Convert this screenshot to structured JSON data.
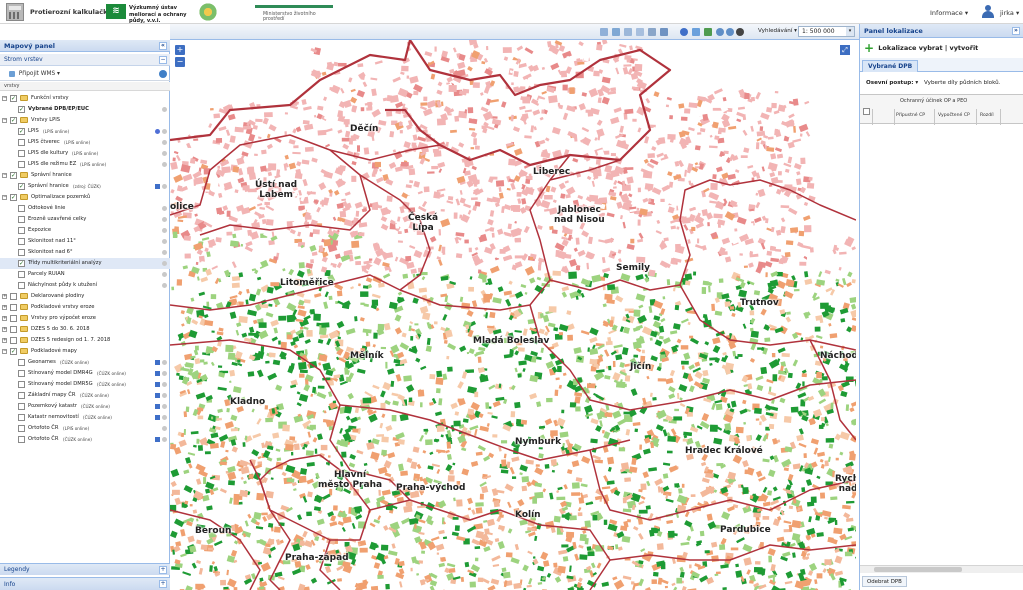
{
  "header": {
    "app_title": "Protierozní kalkulačka",
    "org_name": "Výzkumný ústav meliorací a ochrany půdy, v.v.i.",
    "ministry": "Ministerstvo životního prostředí",
    "info_menu": "Informace ▾",
    "user": "jirka ▾"
  },
  "left_panel": {
    "title": "Mapový panel",
    "subpanel": "Strom vrstev",
    "connect_wms": "Připojit WMS ▾",
    "column_header": "vrstvy",
    "tree": [
      {
        "label": "Funkční vrstvy",
        "level": 0,
        "type": "group",
        "checked": true,
        "expanded": true
      },
      {
        "label": "Vybrané DPB/EP/EUC",
        "level": 1,
        "type": "layer",
        "checked": true,
        "bold": true
      },
      {
        "label": "Vrstvy LPIS",
        "level": 0,
        "type": "group",
        "checked": true,
        "expanded": true
      },
      {
        "label": "LPIS",
        "suffix": "(LPIS online)",
        "level": 1,
        "type": "layer",
        "checked": true,
        "dot": "blue"
      },
      {
        "label": "LPIS čtverec",
        "suffix": "(LPIS online)",
        "level": 1,
        "type": "layer",
        "checked": false
      },
      {
        "label": "LPIS dle kultury",
        "suffix": "(LPIS online)",
        "level": 1,
        "type": "layer",
        "checked": false
      },
      {
        "label": "LPIS dle režimu EZ",
        "suffix": "(LPIS online)",
        "level": 1,
        "type": "layer",
        "checked": false
      },
      {
        "label": "Správní hranice",
        "level": 0,
        "type": "group",
        "checked": true,
        "expanded": true
      },
      {
        "label": "Správní hranice",
        "suffix": "(zdroj: ČÚZK)",
        "level": 1,
        "type": "layer",
        "checked": true,
        "square": true
      },
      {
        "label": "Optimalizace pozemků",
        "level": 0,
        "type": "group",
        "checked": true,
        "expanded": true
      },
      {
        "label": "Odtokové linie",
        "level": 1,
        "type": "layer",
        "checked": false
      },
      {
        "label": "Erozně uzavřené celky",
        "level": 1,
        "type": "layer",
        "checked": false
      },
      {
        "label": "Expozice",
        "level": 1,
        "type": "layer",
        "checked": false
      },
      {
        "label": "Sklonitost nad 11°",
        "level": 1,
        "type": "layer",
        "checked": false
      },
      {
        "label": "Sklonitost nad 6°",
        "level": 1,
        "type": "layer",
        "checked": false
      },
      {
        "label": "Třídy multikriteriální analýzy",
        "level": 1,
        "type": "layer",
        "checked": true,
        "selected": true
      },
      {
        "label": "Parcely RUIAN",
        "level": 1,
        "type": "layer",
        "checked": false
      },
      {
        "label": "Náchylnost půdy k utužení",
        "level": 1,
        "type": "layer",
        "checked": false
      },
      {
        "label": "Deklarované plodiny",
        "level": 0,
        "type": "group",
        "checked": false,
        "expanded": false
      },
      {
        "label": "Podkladové vrstvy eroze",
        "level": 0,
        "type": "group",
        "checked": false,
        "expanded": false
      },
      {
        "label": "Vrstvy pro výpočet eroze",
        "level": 0,
        "type": "group",
        "checked": false,
        "expanded": false
      },
      {
        "label": "DZES 5 do 30. 6. 2018",
        "level": 0,
        "type": "group",
        "checked": false,
        "expanded": false
      },
      {
        "label": "DZES 5 redesign od 1. 7. 2018",
        "level": 0,
        "type": "group",
        "checked": false,
        "expanded": false
      },
      {
        "label": "Podkladové mapy",
        "level": 0,
        "type": "group",
        "checked": true,
        "expanded": true
      },
      {
        "label": "Geonames",
        "suffix": "(ČÚZK online)",
        "level": 1,
        "type": "layer",
        "checked": false,
        "square": true
      },
      {
        "label": "Stínovaný model DMR4G",
        "suffix": "(ČÚZK online)",
        "level": 1,
        "type": "layer",
        "checked": false,
        "square": true
      },
      {
        "label": "Stínovaný model DMR5G",
        "suffix": "(ČÚZK online)",
        "level": 1,
        "type": "layer",
        "checked": false,
        "square": true
      },
      {
        "label": "Základní mapy ČR",
        "suffix": "(ČÚZK online)",
        "level": 1,
        "type": "layer",
        "checked": false,
        "square": true
      },
      {
        "label": "Pozemkový katastr",
        "suffix": "(ČÚZK online)",
        "level": 1,
        "type": "layer",
        "checked": false,
        "square": true
      },
      {
        "label": "Katastr nemovitostí",
        "suffix": "(ČÚZK online)",
        "level": 1,
        "type": "layer",
        "checked": false,
        "square": true
      },
      {
        "label": "Ortofoto ČR",
        "suffix": "(LPIS online)",
        "level": 1,
        "type": "layer",
        "checked": false
      },
      {
        "label": "Ortofoto ČR",
        "suffix": "(ČÚZK online)",
        "level": 1,
        "type": "layer",
        "checked": false,
        "square": true
      }
    ],
    "legend_panel": "Legendy",
    "info_panel": "Info"
  },
  "toolbar": {
    "search_label": "Vyhledávání ▾",
    "scale_value": "1: 500 000",
    "icons": [
      "select-icon",
      "measure-icon",
      "draw-icon",
      "area-icon",
      "print-icon",
      "export-icon",
      "info-icon",
      "layers-icon",
      "pin-icon",
      "zoom-in-icon",
      "zoom-out-icon",
      "cancel-icon"
    ]
  },
  "map": {
    "zoom_in": "+",
    "zoom_out": "−",
    "labels": [
      {
        "text": "Děčín"
      },
      {
        "text": "Ústí nad\nLabem"
      },
      {
        "text": "Liberec"
      },
      {
        "text": "Jablonec\nnad Nisou"
      },
      {
        "text": "Česká\nLípa"
      },
      {
        "text": "Semily"
      },
      {
        "text": "Litoměřice"
      },
      {
        "text": "Trutnov"
      },
      {
        "text": "Mladá Boleslav"
      },
      {
        "text": "Mělník"
      },
      {
        "text": "Jičín"
      },
      {
        "text": "Náchod"
      },
      {
        "text": "Kladno"
      },
      {
        "text": "Nymburk"
      },
      {
        "text": "Hradec Králové"
      },
      {
        "text": "Hlavní\nměsto Praha"
      },
      {
        "text": "Praha-východ"
      },
      {
        "text": "Rychnov\nnad Kn"
      },
      {
        "text": "Kolín"
      },
      {
        "text": "Beroun"
      },
      {
        "text": "Pardubice"
      },
      {
        "text": "Praha-západ"
      },
      {
        "text": "olice"
      }
    ]
  },
  "right_panel": {
    "title": "Panel lokalizace",
    "lokalizace_label": "Lokalizace vybrat | vytvořit",
    "tab_label": "Vybrané DPB",
    "osevni_postup_label": "Osevní postup: ▾",
    "osevni_postup_hint": "Vyberte díly půdních bloků.",
    "grid_header": "Ochranný účinek OP a PEO",
    "grid_cols": [
      "Přípustné CP",
      "Vypočtené CP",
      "Rozdíl"
    ],
    "remove_button": "Odebrat DPB"
  },
  "colors": {
    "panel_header": "#dfe9f6",
    "panel_border": "#99bbe8",
    "boundary": "#b0323c",
    "green_dark": "#1e9b34",
    "green_light": "#9dd37f",
    "orange": "#f0a070",
    "pink": "#f2b4b4"
  }
}
